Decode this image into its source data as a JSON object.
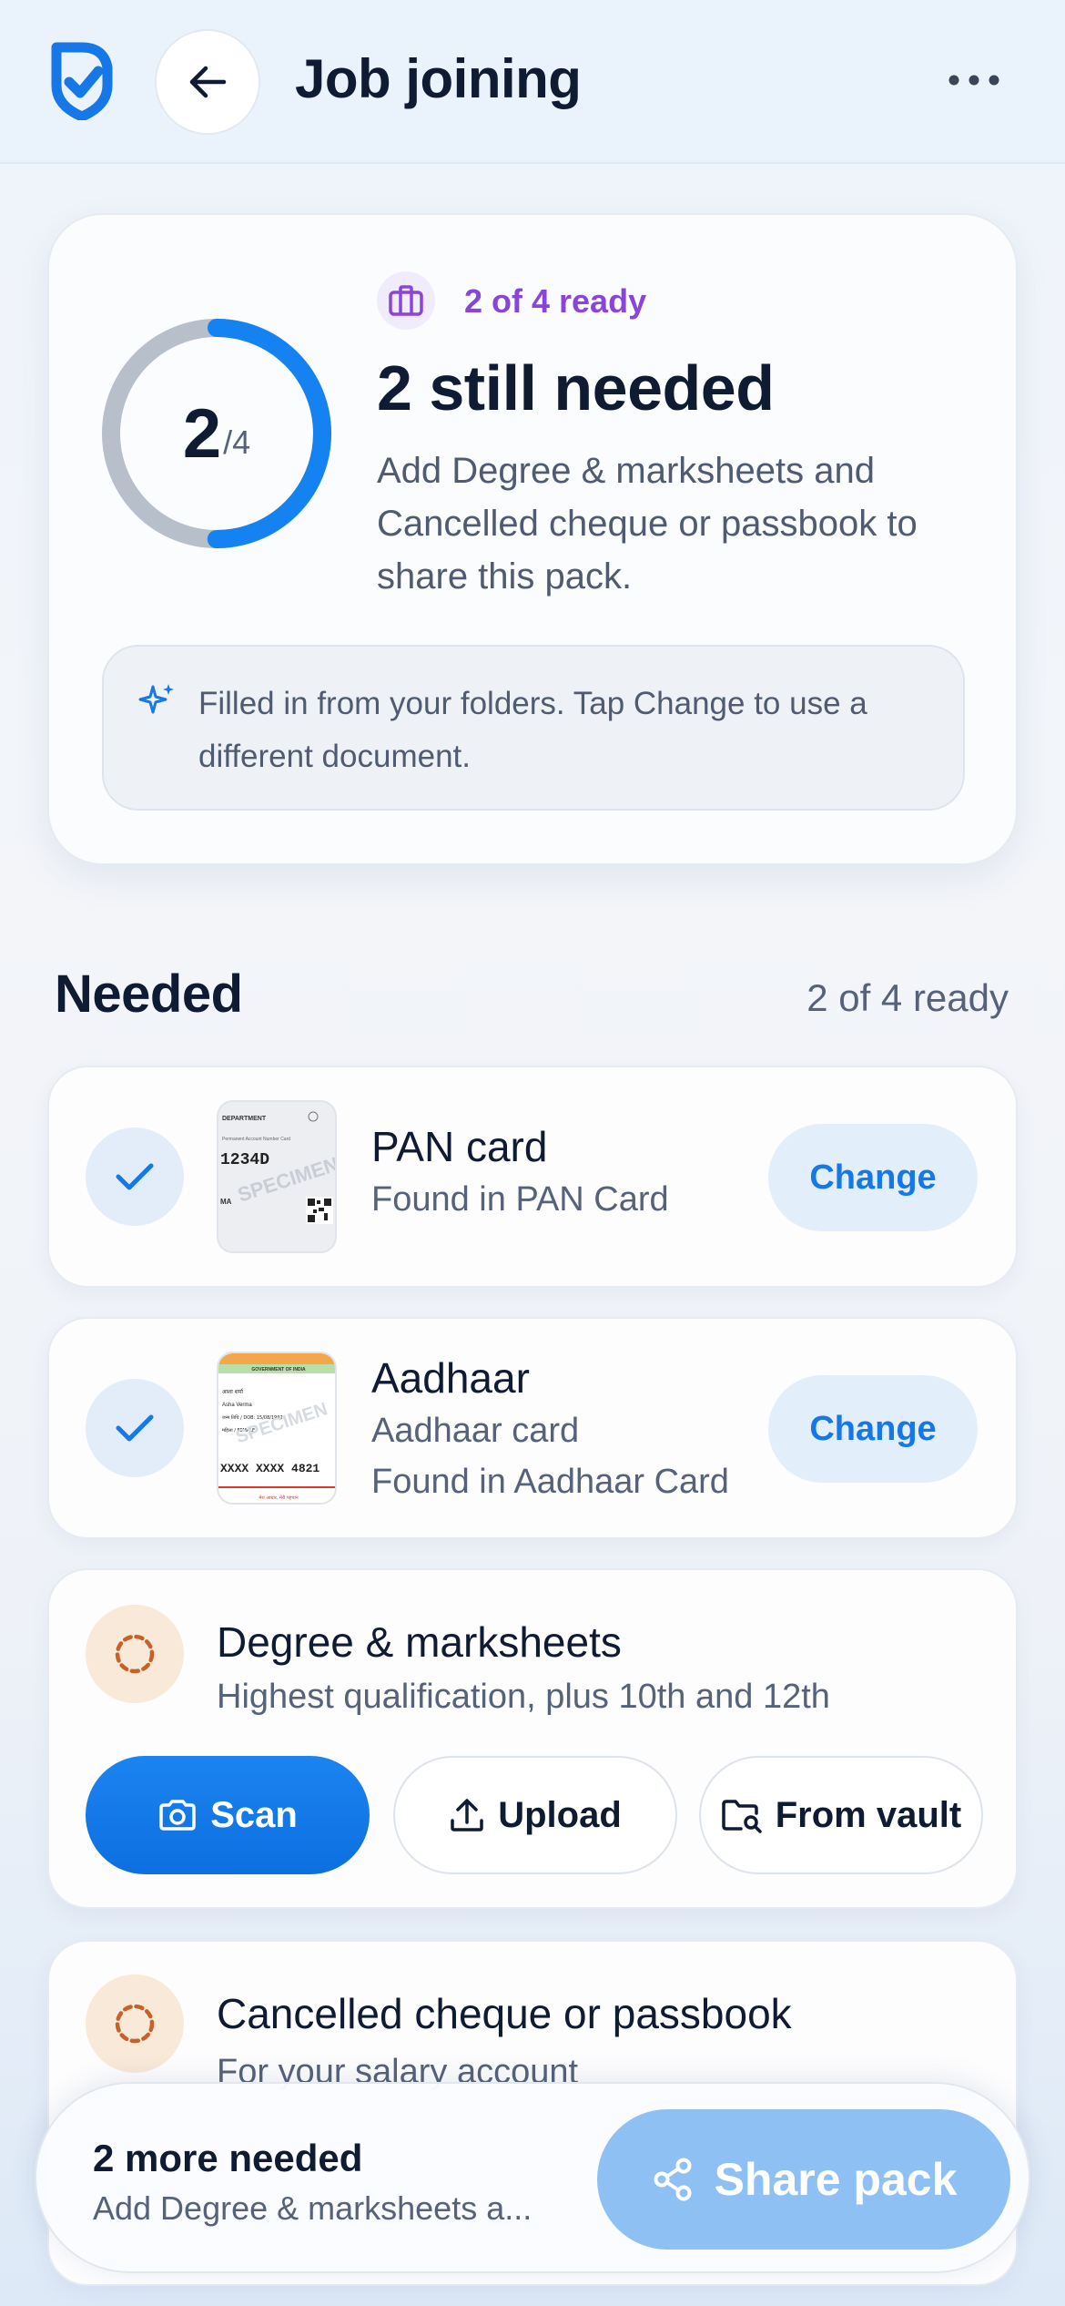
{
  "header": {
    "title": "Job joining"
  },
  "summary": {
    "ring_count": "2",
    "ring_total": "/4",
    "progress_fraction": 0.5,
    "pack_ready": "2 of 4 ready",
    "still_needed": "2 still needed",
    "description": "Add Degree & marksheets and Cancelled cheque or passbook to share this pack.",
    "hint": "Filled in from your folders. Tap Change to use a different document."
  },
  "section": {
    "title": "Needed",
    "count": "2 of 4 ready"
  },
  "items": [
    {
      "title": "PAN card",
      "found": "Found in PAN Card",
      "change_label": "Change",
      "thumb_text": [
        "DEPARTMENT",
        "Permanent Account Number Card",
        "1234D",
        "MA",
        "SPECIMEN"
      ]
    },
    {
      "title": "Aadhaar",
      "subtitle": "Aadhaar card",
      "found": "Found in Aadhaar Card",
      "change_label": "Change",
      "thumb_text": [
        "GOVERNMENT OF INDIA",
        "आशा शर्मा",
        "Asha Verma",
        "जन्म तिथि / DOB: 15/08/1992",
        "महिला / FEMALE",
        "XXXX XXXX 4821",
        "मेरा आधार, मेरी पहचान",
        "SPECIMEN"
      ]
    }
  ],
  "pending": [
    {
      "title": "Degree & marksheets",
      "subtitle": "Highest qualification, plus 10th and 12th",
      "actions": {
        "scan": "Scan",
        "upload": "Upload",
        "vault": "From vault"
      }
    },
    {
      "title": "Cancelled cheque or passbook",
      "subtitle": "For your salary account"
    }
  ],
  "bottom": {
    "title": "2 more needed",
    "subtitle": "Add Degree & marksheets a...",
    "share_label": "Share pack"
  },
  "colors": {
    "accent": "#1677e6",
    "purple": "#8a44dc",
    "ring_track": "#b7bfcb",
    "pending_bg": "#f8e9d8",
    "pending_ring": "#c8602a"
  }
}
